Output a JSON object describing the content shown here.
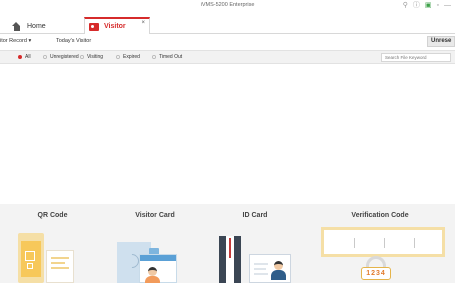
{
  "app": {
    "title": "iVMS-5200 Enterprise"
  },
  "window_controls": {
    "user_icon": "user-icon",
    "help_icon": "help-icon",
    "status_icon": "status-icon",
    "menu_icon": "menu-icon"
  },
  "tabs": [
    {
      "label": "Home",
      "icon": "home-icon",
      "active": false
    },
    {
      "label": "Visitor",
      "icon": "visitor-icon",
      "active": true,
      "close": "×"
    }
  ],
  "submenu": {
    "record_label": "itor Record",
    "record_arrow": "▾",
    "today_label": "Today's Visitor",
    "unreserved_label": "Unrese"
  },
  "filters": {
    "options": [
      {
        "label": "All",
        "selected": true
      },
      {
        "label": "Unregistered",
        "selected": false
      },
      {
        "label": "Visiting",
        "selected": false
      },
      {
        "label": "Expired",
        "selected": false
      },
      {
        "label": "Timed Out",
        "selected": false
      }
    ],
    "search_placeholder": "Search File Keyword"
  },
  "cards": [
    {
      "title": "QR Code"
    },
    {
      "title": "Visitor Card"
    },
    {
      "title": "ID Card"
    },
    {
      "title": "Verification Code",
      "code_digits": "1234"
    }
  ],
  "colors": {
    "accent": "#d62b2b",
    "card_bg": "#f3f3f3",
    "filter_bg": "#f2f2f2"
  }
}
